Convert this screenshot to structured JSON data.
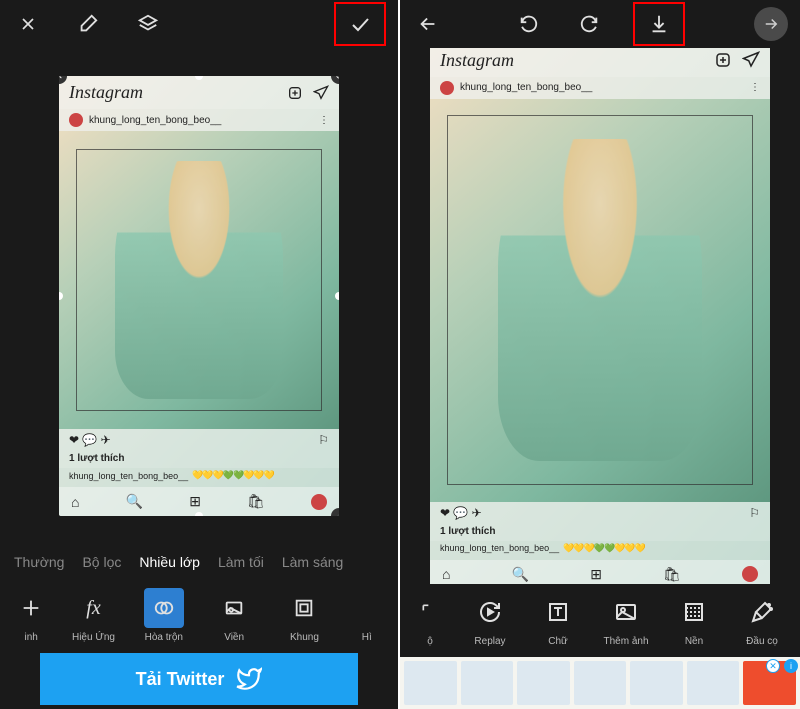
{
  "left": {
    "topbar": {
      "close": "close-icon",
      "eraser": "eraser-icon",
      "layers": "layers-icon",
      "confirm": "check-icon"
    },
    "tabs": [
      {
        "label": "Thường",
        "active": false
      },
      {
        "label": "Bộ lọc",
        "active": false
      },
      {
        "label": "Nhiều lớp",
        "active": true
      },
      {
        "label": "Làm tối",
        "active": false
      },
      {
        "label": "Làm sáng",
        "active": false
      }
    ],
    "tools": [
      {
        "label": "inh",
        "icon": "plus",
        "partial": true
      },
      {
        "label": "Hiệu Ứng",
        "icon": "fx"
      },
      {
        "label": "Hòa trộn",
        "icon": "blend",
        "active": true
      },
      {
        "label": "Viền",
        "icon": "border"
      },
      {
        "label": "Khung",
        "icon": "frame"
      },
      {
        "label": "Hì",
        "icon": "",
        "partial": true
      }
    ],
    "ad": {
      "text": "Tải Twitter",
      "icon": "twitter"
    }
  },
  "right": {
    "topbar": {
      "back": "back-icon",
      "undo": "undo-icon",
      "redo": "redo-icon",
      "download": "download-icon",
      "next": "next-icon"
    },
    "tools": [
      {
        "label": "ộ",
        "icon": "",
        "partial": true
      },
      {
        "label": "Replay",
        "icon": "replay"
      },
      {
        "label": "Chữ",
        "icon": "text"
      },
      {
        "label": "Thêm ảnh",
        "icon": "image"
      },
      {
        "label": "Nền",
        "icon": "background"
      },
      {
        "label": "Đầu cọ",
        "icon": "brush"
      }
    ]
  },
  "instagram": {
    "logo": "Instagram",
    "username": "khung_long_ten_bong_beo__",
    "likes_text": "1 lượt thích",
    "caption_user": "khung_long_ten_bong_beo__",
    "emoji": "💛💛💛💚💚💛💛💛"
  }
}
